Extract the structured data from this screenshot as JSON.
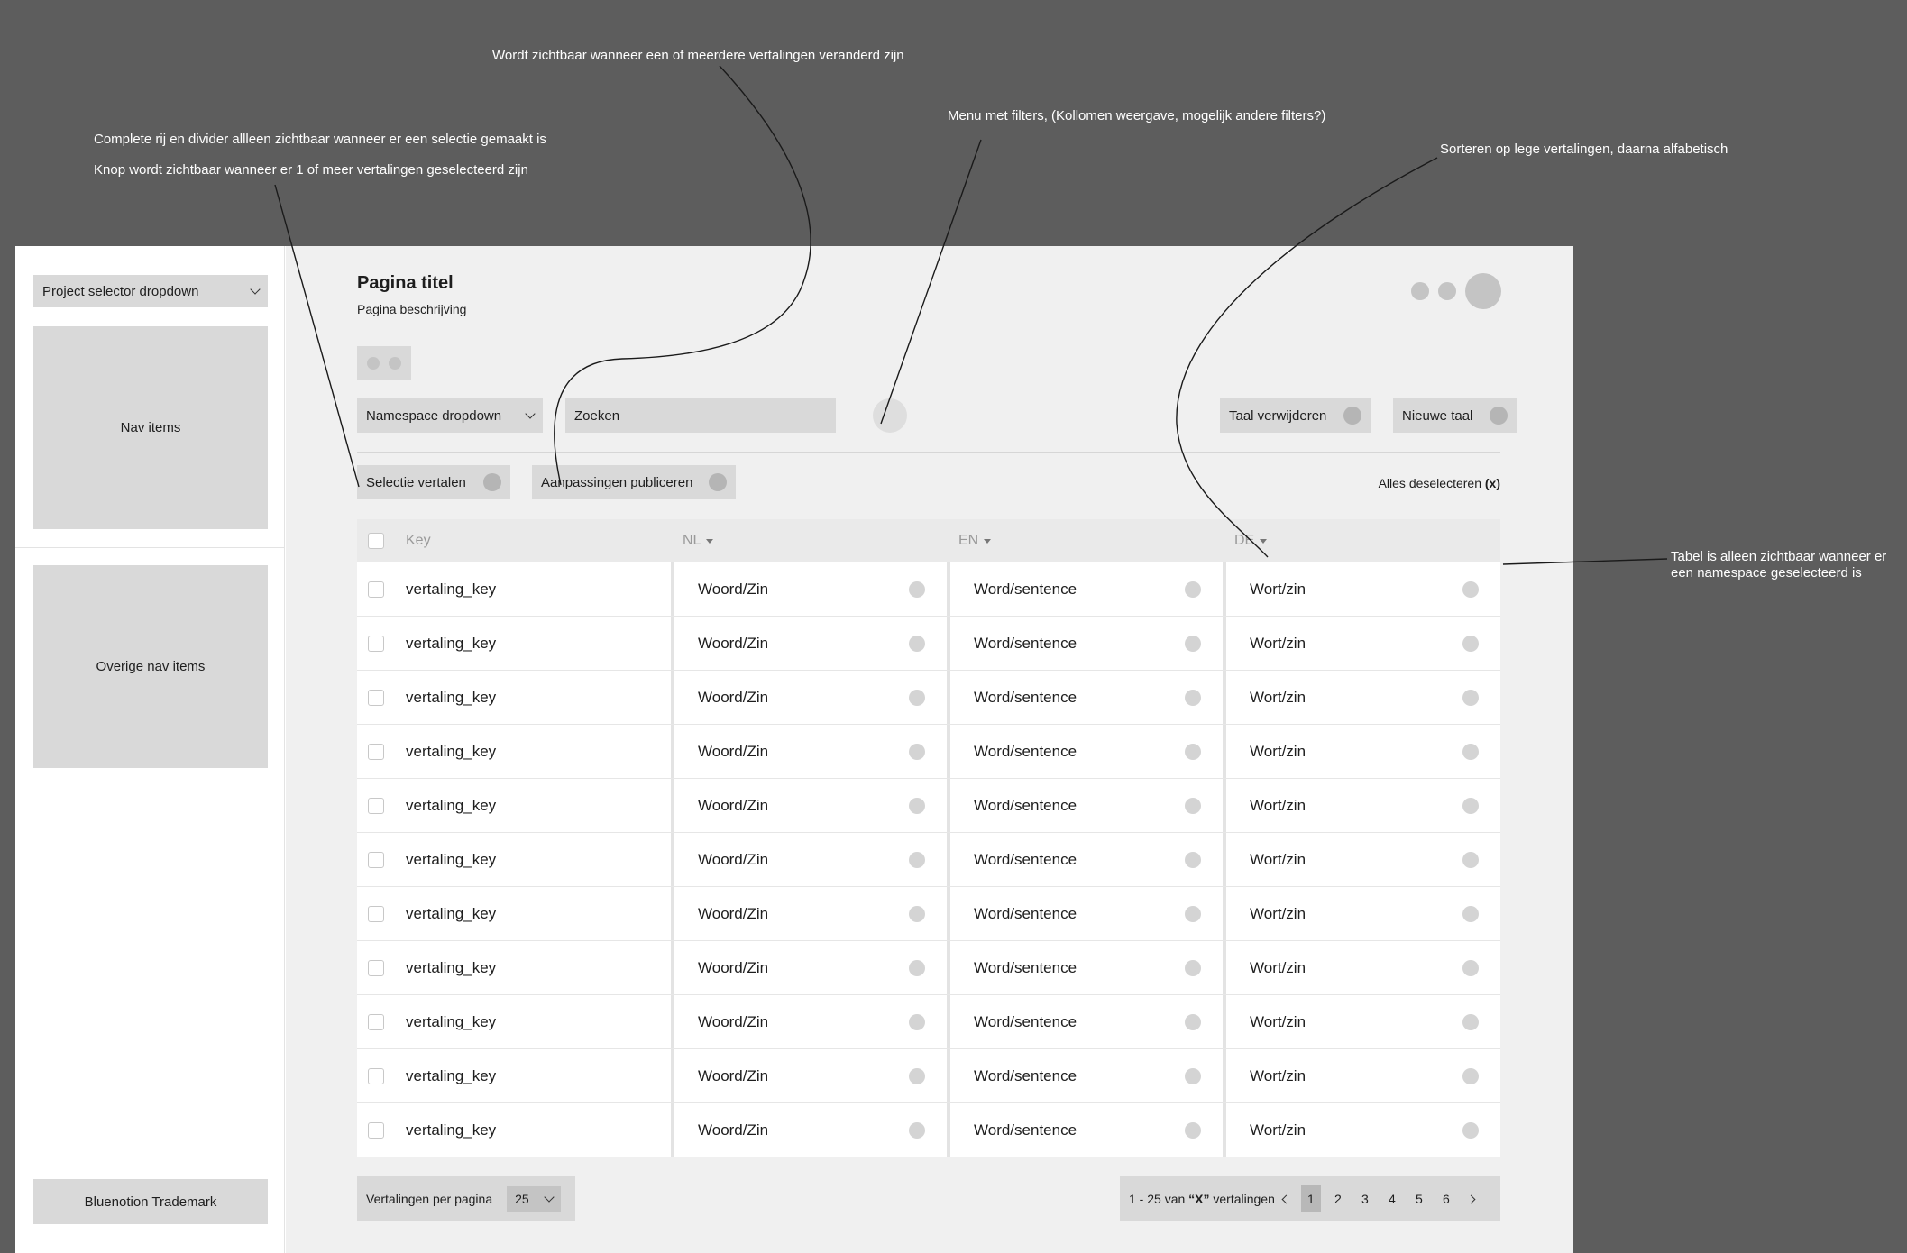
{
  "annotations": {
    "published_visible": "Wordt zichtbaar wanneer  een of meerdere vertalingen veranderd zijn",
    "filter_menu": "Menu met filters, (Kollomen weergave, mogelijk andere filters?)",
    "row_divider": "Complete rij en divider allleen zichtbaar wanneer er een selectie gemaakt is",
    "button_visible": "Knop wordt zichtbaar wanneer er 1 of meer vertalingen geselecteerd zijn",
    "sorting": "Sorteren op lege vertalingen, daarna alfabetisch",
    "table_visible_1": "Tabel is alleen zichtbaar wanneer er",
    "table_visible_2": "een namespace geselecteerd is"
  },
  "sidebar": {
    "project_selector": "Project selector dropdown",
    "nav_items": "Nav items",
    "other_nav_items": "Overige nav items",
    "trademark": "Bluenotion Trademark"
  },
  "header": {
    "title": "Pagina titel",
    "description": "Pagina beschrijving"
  },
  "toolbar": {
    "namespace_dropdown": "Namespace dropdown",
    "search_placeholder": "Zoeken",
    "delete_language": "Taal verwijderen",
    "new_language": "Nieuwe taal"
  },
  "selection_bar": {
    "translate_selection": "Selectie vertalen",
    "publish_changes": "Aanpassingen publiceren",
    "deselect_all": "Alles deselecteren",
    "deselect_x": "(x)"
  },
  "table": {
    "columns": [
      "Key",
      "NL",
      "EN",
      "DE"
    ],
    "rows": [
      {
        "key": "vertaling_key",
        "nl": "Woord/Zin",
        "en": "Word/sentence",
        "de": "Wort/zin"
      },
      {
        "key": "vertaling_key",
        "nl": "Woord/Zin",
        "en": "Word/sentence",
        "de": "Wort/zin"
      },
      {
        "key": "vertaling_key",
        "nl": "Woord/Zin",
        "en": "Word/sentence",
        "de": "Wort/zin"
      },
      {
        "key": "vertaling_key",
        "nl": "Woord/Zin",
        "en": "Word/sentence",
        "de": "Wort/zin"
      },
      {
        "key": "vertaling_key",
        "nl": "Woord/Zin",
        "en": "Word/sentence",
        "de": "Wort/zin"
      },
      {
        "key": "vertaling_key",
        "nl": "Woord/Zin",
        "en": "Word/sentence",
        "de": "Wort/zin"
      },
      {
        "key": "vertaling_key",
        "nl": "Woord/Zin",
        "en": "Word/sentence",
        "de": "Wort/zin"
      },
      {
        "key": "vertaling_key",
        "nl": "Woord/Zin",
        "en": "Word/sentence",
        "de": "Wort/zin"
      },
      {
        "key": "vertaling_key",
        "nl": "Woord/Zin",
        "en": "Word/sentence",
        "de": "Wort/zin"
      },
      {
        "key": "vertaling_key",
        "nl": "Woord/Zin",
        "en": "Word/sentence",
        "de": "Wort/zin"
      },
      {
        "key": "vertaling_key",
        "nl": "Woord/Zin",
        "en": "Word/sentence",
        "de": "Wort/zin"
      }
    ]
  },
  "pagination": {
    "per_page_label": "Vertalingen per pagina",
    "per_page_value": "25",
    "range_prefix": "1 - 25 van ",
    "range_x": "“X”",
    "range_suffix": " vertalingen",
    "pages": [
      "1",
      "2",
      "3",
      "4",
      "5",
      "6"
    ],
    "active_page": "1"
  },
  "colors": {
    "background": "#5d5d5d",
    "main": "#f0f0f0",
    "block": "#d9d9d9"
  },
  "icons": {
    "dropdown": "chevron-down-icon",
    "sort": "caret-down-icon",
    "button_action": "circle-icon",
    "pager_prev": "chevron-left-icon",
    "pager_next": "chevron-right-icon"
  }
}
